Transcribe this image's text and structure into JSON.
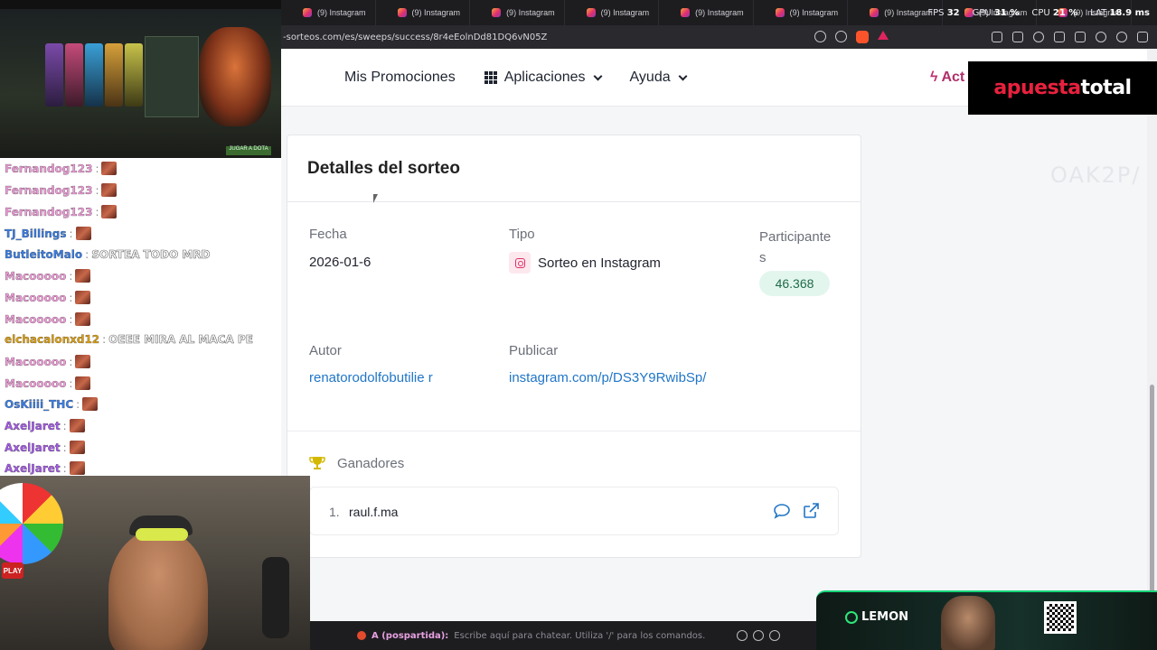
{
  "browser": {
    "tabs": [
      "(9) Instagram",
      "(9) Instagram",
      "(9) Instagram",
      "(9) Instagram",
      "(9) Instagram",
      "(9) Instagram",
      "(9) Instagram",
      "(9) Instagram",
      "(9) Instagram"
    ],
    "url": "-sorteos.com/es/sweeps/success/8r4eEolnDd81DQ6vN05Z",
    "perf": {
      "fps_label": "FPS",
      "fps": "32",
      "gpu_label": "GPU",
      "gpu": "31 %",
      "cpu_label": "CPU",
      "cpu": "21 %",
      "lat_label": "LAT",
      "lat": "18.9 ms"
    }
  },
  "header": {
    "nav": {
      "promos": "Mis Promociones",
      "apps": "Aplicaciones",
      "help": "Ayuda"
    },
    "action": "Act"
  },
  "details": {
    "title": "Detalles del sorteo",
    "date_label": "Fecha",
    "date": "2026-01-6",
    "type_label": "Tipo",
    "type": "Sorteo en Instagram",
    "participants_label": "Participante s",
    "participants": "46.368",
    "author_label": "Autor",
    "author": "renatorodolfobutilie r",
    "publish_label": "Publicar",
    "publish_link": "instagram.com/p/DS3Y9RwibSp/",
    "winners_label": "Ganadores",
    "winners": [
      {
        "num": "1.",
        "name": "raul.f.ma"
      }
    ]
  },
  "chat": {
    "messages": [
      {
        "user": "Fernandog123",
        "color": "#f19bd9",
        "text": ""
      },
      {
        "user": "Fernandog123",
        "color": "#f19bd9",
        "text": ""
      },
      {
        "user": "Fernandog123",
        "color": "#f19bd9",
        "text": ""
      },
      {
        "user": "TJ_Billings",
        "color": "#3a7ee6",
        "text": ""
      },
      {
        "user": "ButleitoMalo",
        "color": "#3a7ee6",
        "text": "SORTEA TODO MRD"
      },
      {
        "user": "Macooooo",
        "color": "#f19bd9",
        "text": ""
      },
      {
        "user": "Macooooo",
        "color": "#f19bd9",
        "text": ""
      },
      {
        "user": "Macooooo",
        "color": "#f19bd9",
        "text": ""
      },
      {
        "user": "elchacalonxd12",
        "color": "#e0a10e",
        "text": "OEEE MIRA AL MACA PE"
      },
      {
        "user": "Macooooo",
        "color": "#f19bd9",
        "text": ""
      },
      {
        "user": "Macooooo",
        "color": "#f19bd9",
        "text": ""
      },
      {
        "user": "OsKiiii_THC",
        "color": "#3a7ee6",
        "text": ""
      },
      {
        "user": "AxelJaret",
        "color": "#a55ae8",
        "text": ""
      },
      {
        "user": "AxelJaret",
        "color": "#a55ae8",
        "text": ""
      },
      {
        "user": "AxelJaret",
        "color": "#a55ae8",
        "text": ""
      }
    ],
    "input_user": "A (pospartida):",
    "input_hint": "Escribe aquí para chatear. Utiliza '/' para los comandos."
  },
  "overlays": {
    "sponsor_a": "apuesta",
    "sponsor_b": "total",
    "lemon": "LEMON",
    "game_button": "JUGAR A DOTA",
    "play_badge": "PLAY"
  }
}
